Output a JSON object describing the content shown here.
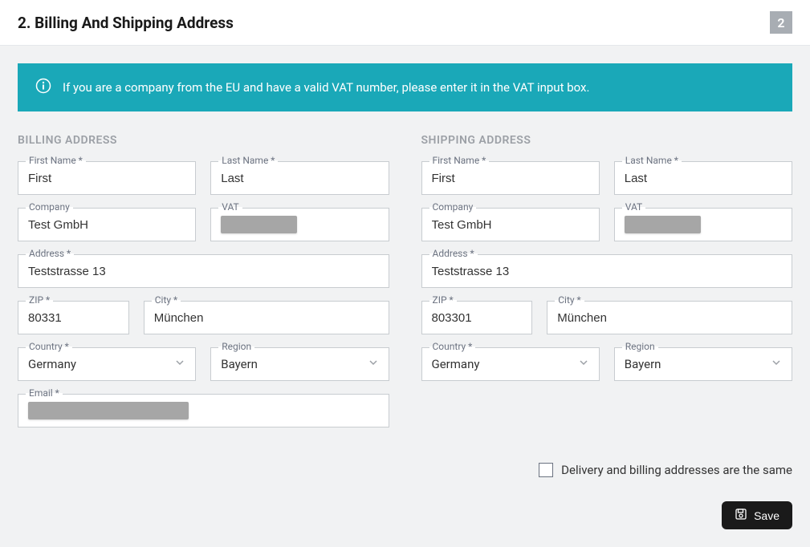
{
  "header": {
    "title": "2. Billing And Shipping Address",
    "step": "2"
  },
  "alert": {
    "text": "If you are a company from the EU and have a valid VAT number, please enter it in the VAT input box."
  },
  "sections": {
    "billing_heading": "BILLING ADDRESS",
    "shipping_heading": "SHIPPING ADDRESS"
  },
  "labels": {
    "first_name": "First Name *",
    "last_name": "Last Name *",
    "company": "Company",
    "vat": "VAT",
    "address": "Address *",
    "zip": "ZIP *",
    "city": "City *",
    "country": "Country *",
    "region": "Region",
    "email": "Email *"
  },
  "billing": {
    "first_name": "First",
    "last_name": "Last",
    "company": "Test GmbH",
    "vat": "",
    "address": "Teststrasse 13",
    "zip": "80331",
    "city": "München",
    "country": "Germany",
    "region": "Bayern",
    "email": ""
  },
  "shipping": {
    "first_name": "First",
    "last_name": "Last",
    "company": "Test GmbH",
    "vat": "",
    "address": "Teststrasse 13",
    "zip": "803301",
    "city": "München",
    "country": "Germany",
    "region": "Bayern"
  },
  "footer": {
    "same_address_label": "Delivery and billing addresses are the same",
    "save_label": "Save"
  }
}
